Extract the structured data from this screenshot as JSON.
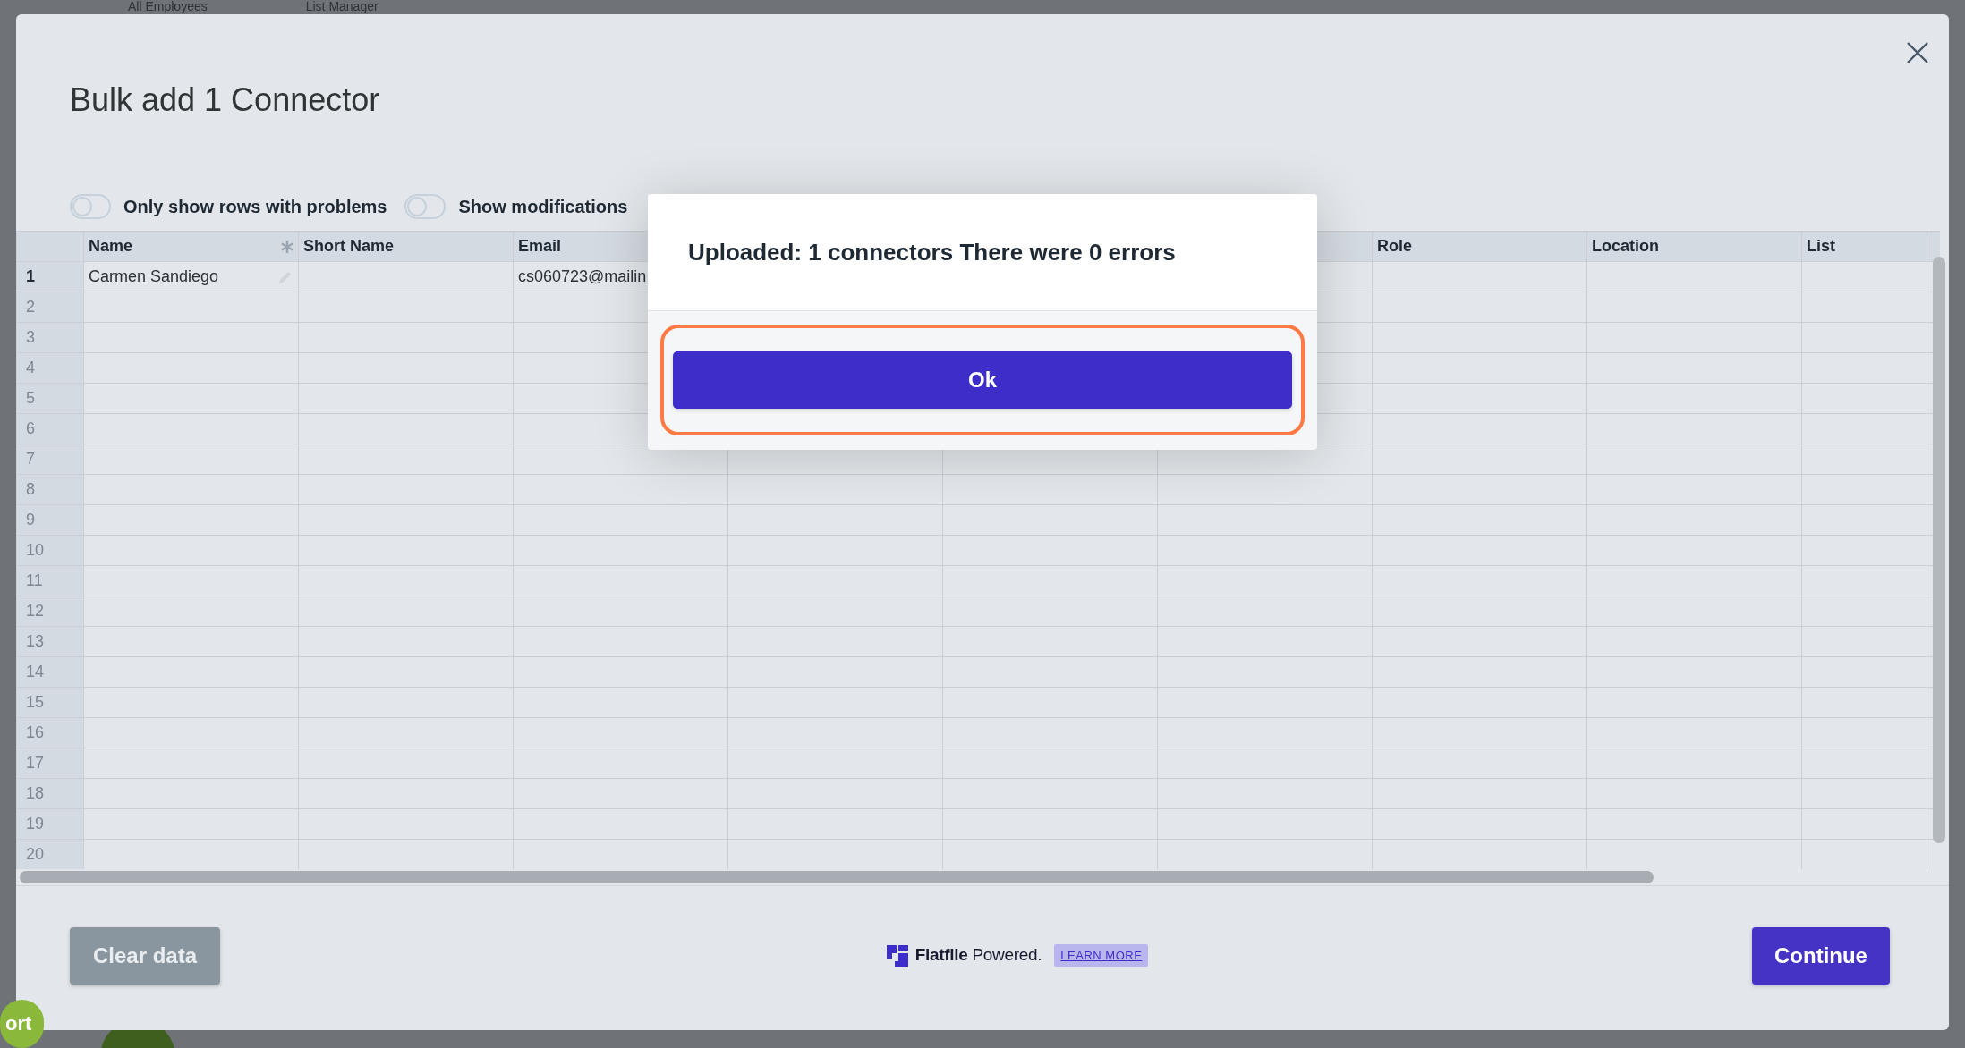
{
  "background": {
    "tabs": [
      "All Employees",
      "List Manager"
    ],
    "support_button": "ort"
  },
  "modal": {
    "title": "Bulk add 1 Connector",
    "toggles": [
      {
        "label": "Only show rows with problems",
        "on": false
      },
      {
        "label": "Show modifications",
        "on": false
      }
    ],
    "table": {
      "columns": [
        {
          "kind": "field",
          "label": "Name",
          "required": true
        },
        {
          "kind": "field",
          "label": "Short Name"
        },
        {
          "kind": "field",
          "label": "Email"
        },
        {
          "kind": "covered"
        },
        {
          "kind": "covered"
        },
        {
          "kind": "covered"
        },
        {
          "kind": "field",
          "label": "Role"
        },
        {
          "kind": "field",
          "label": "Location"
        },
        {
          "kind": "field",
          "label": "List"
        }
      ],
      "rows": [
        {
          "number": "1",
          "cells": [
            "Carmen Sandiego",
            null,
            "cs060723@mailin"
          ]
        },
        {
          "number": "2"
        },
        {
          "number": "3"
        },
        {
          "number": "4"
        },
        {
          "number": "5"
        },
        {
          "number": "6"
        },
        {
          "number": "7"
        },
        {
          "number": "8"
        },
        {
          "number": "9"
        },
        {
          "number": "10"
        },
        {
          "number": "11"
        },
        {
          "number": "12"
        },
        {
          "number": "13"
        },
        {
          "number": "14"
        },
        {
          "number": "15"
        },
        {
          "number": "16"
        },
        {
          "number": "17"
        },
        {
          "number": "18"
        },
        {
          "number": "19"
        },
        {
          "number": "20"
        }
      ]
    },
    "footer": {
      "clear_button": "Clear data",
      "brand": "Flatfile",
      "brand_suffix": "Powered.",
      "learn_more": "LEARN MORE",
      "continue_button": "Continue"
    }
  },
  "dialog": {
    "message": "Uploaded: 1 connectors There were 0 errors",
    "ok_button": "Ok",
    "focused": true
  }
}
